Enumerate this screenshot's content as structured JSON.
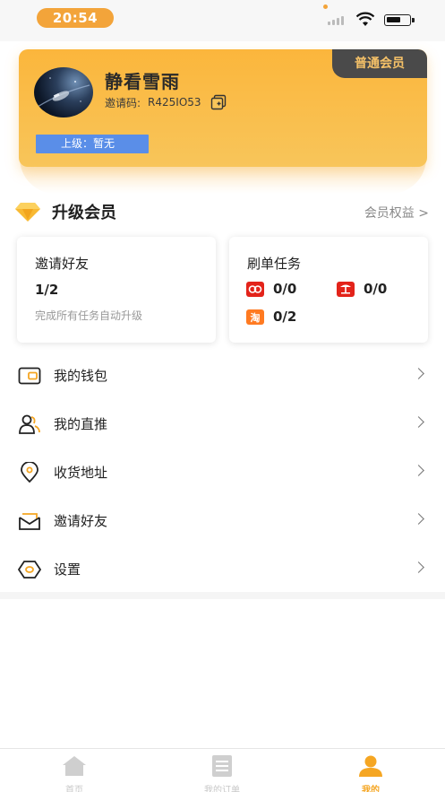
{
  "status_bar": {
    "time": "20:54"
  },
  "profile": {
    "username": "静看雪雨",
    "invite_label": "邀请码:",
    "invite_code": "R425IO53",
    "superior": "上级：暂无",
    "member_level": "普通会员"
  },
  "upgrade": {
    "title": "升级会员",
    "rights_link": "会员权益 >"
  },
  "invite_card": {
    "title": "邀请好友",
    "progress": "1/2",
    "hint": "完成所有任务自动升级"
  },
  "order_card": {
    "title": "刷单任务",
    "platforms": [
      {
        "name": "jd-icon",
        "value": "0/0"
      },
      {
        "name": "pinduoduo-icon",
        "value": "0/0"
      },
      {
        "name": "taobao-icon",
        "value": "0/2"
      }
    ]
  },
  "menu": [
    {
      "label": "我的钱包",
      "icon": "wallet-icon"
    },
    {
      "label": "我的直推",
      "icon": "users-icon"
    },
    {
      "label": "收货地址",
      "icon": "location-icon"
    },
    {
      "label": "邀请好友",
      "icon": "envelope-icon"
    },
    {
      "label": "设置",
      "icon": "settings-icon"
    }
  ],
  "tabs": [
    {
      "label": "首页",
      "icon": "home-icon"
    },
    {
      "label": "我的订单",
      "icon": "orders-icon"
    },
    {
      "label": "我的",
      "icon": "profile-icon",
      "active": true
    }
  ],
  "colors": {
    "accent": "#f5a623",
    "card_gold": "#fbb63c",
    "badge_blue": "#5a8ee8",
    "dark_tag": "#4a4a4a"
  }
}
